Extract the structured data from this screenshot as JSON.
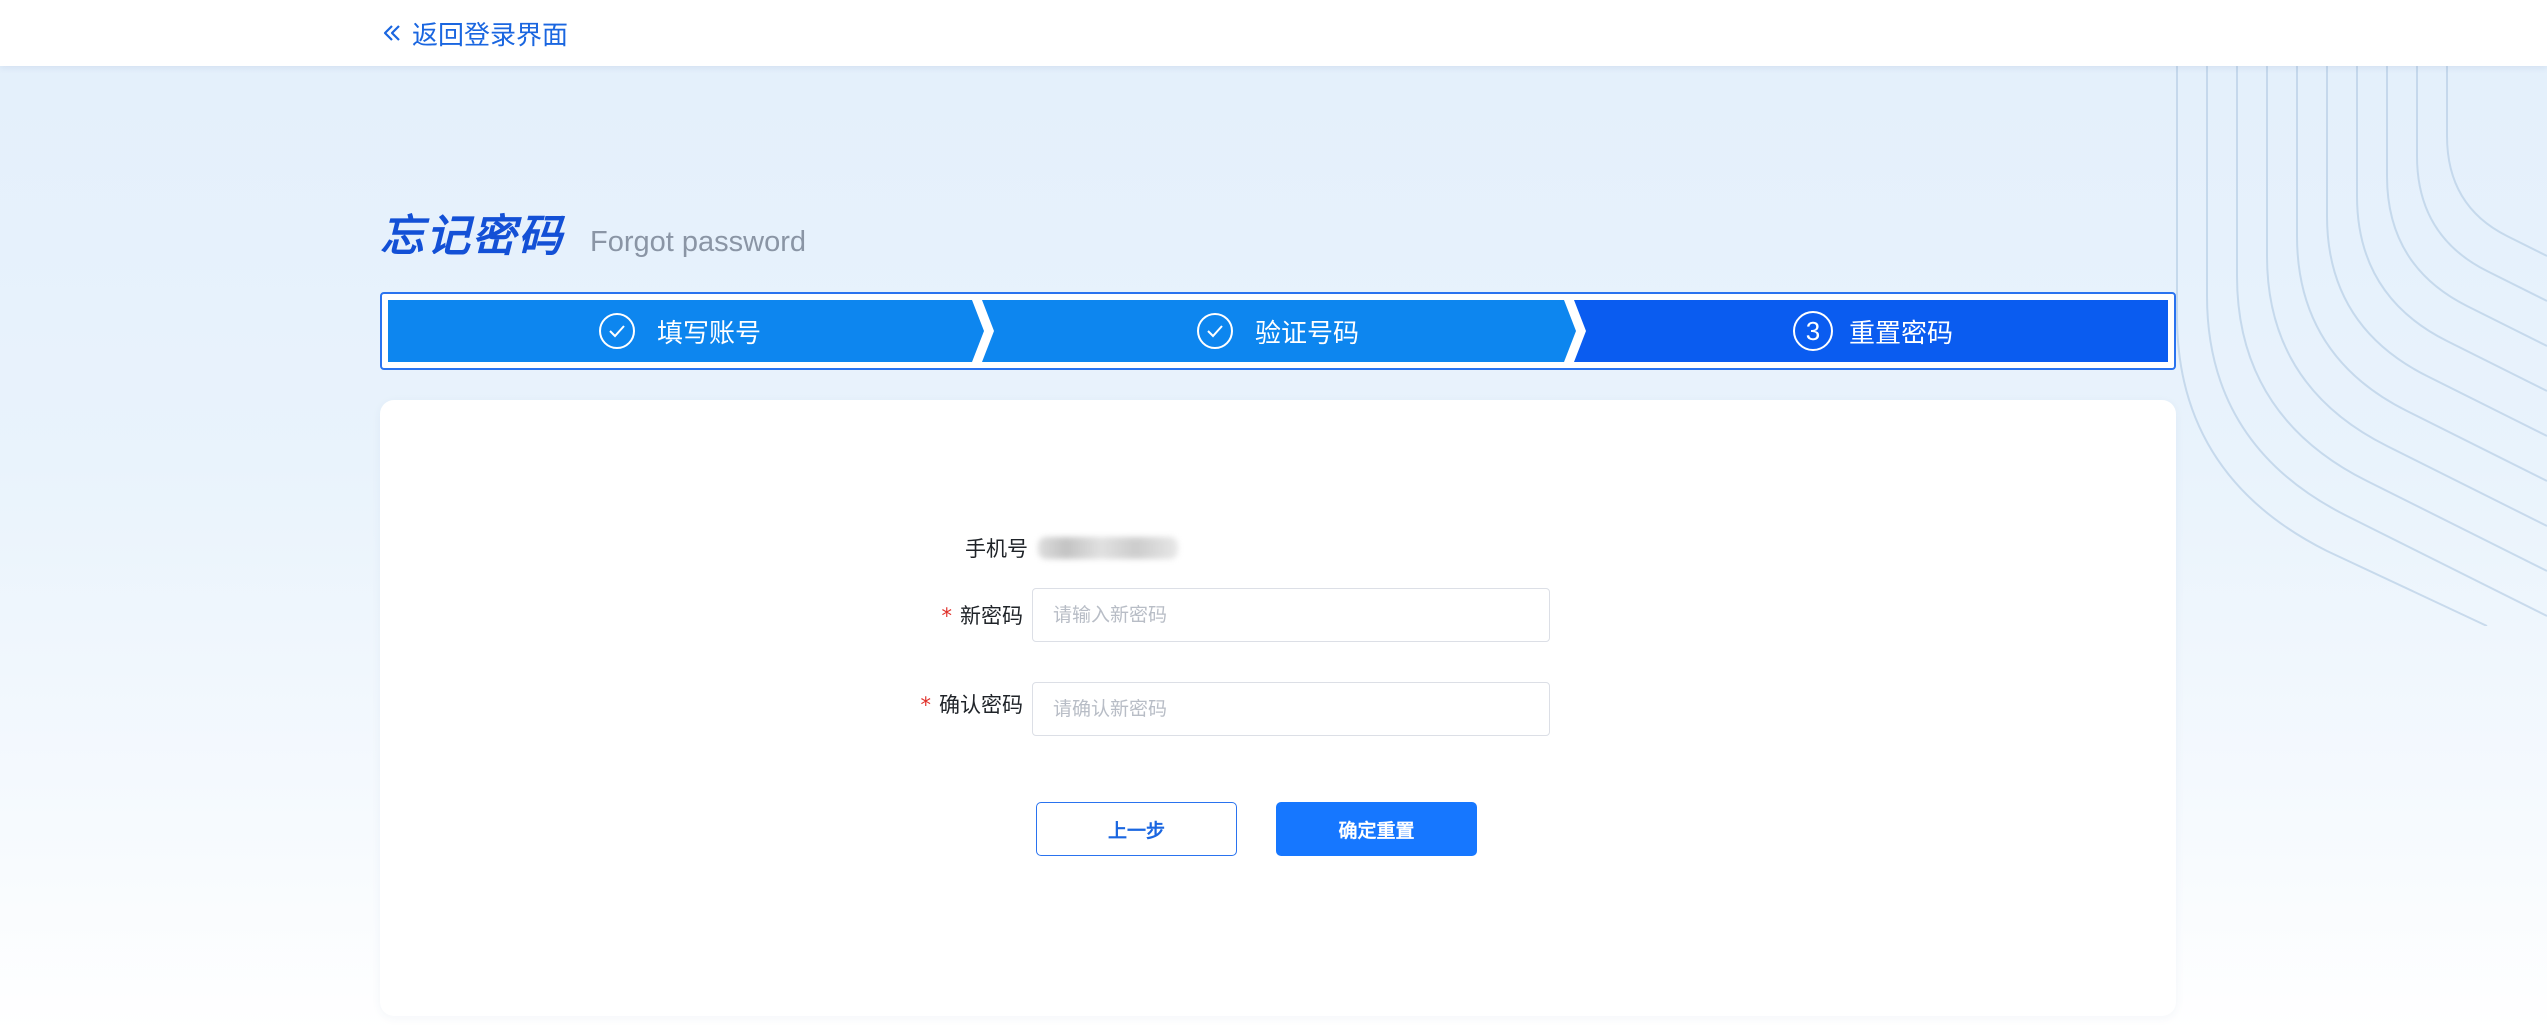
{
  "header": {
    "back_icon": "double-chevron-left-icon",
    "back_label": "返回登录界面"
  },
  "title": {
    "zh": "忘记密码",
    "en": "Forgot password"
  },
  "steps": [
    {
      "label": "填写账号",
      "status": "done",
      "icon": "check-circle-icon"
    },
    {
      "label": "验证号码",
      "status": "done",
      "icon": "check-circle-icon"
    },
    {
      "label": "重置密码",
      "status": "current",
      "number": "3"
    }
  ],
  "form": {
    "phone_label": "手机号",
    "new_password": {
      "label": "新密码",
      "required_mark": "*",
      "placeholder": "请输入新密码",
      "value": ""
    },
    "confirm_password": {
      "label": "确认密码",
      "required_mark": "*",
      "placeholder": "请确认新密码",
      "value": ""
    }
  },
  "buttons": {
    "prev": "上一步",
    "confirm": "确定重置"
  },
  "colors": {
    "step_done": "#0d86ef",
    "step_current": "#0a5cf0",
    "primary": "#1677ff",
    "title": "#1350d6",
    "required": "#e0302a"
  }
}
